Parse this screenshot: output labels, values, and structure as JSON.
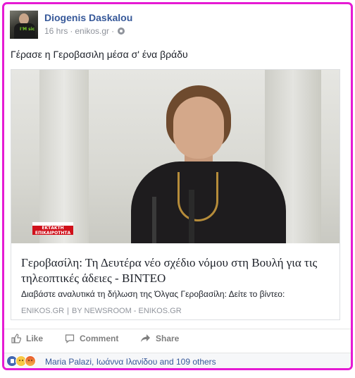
{
  "post": {
    "author_name": "Diogenis Daskalou",
    "time": "16 hrs",
    "source_separator": "·",
    "source_site": "enikos.gr",
    "privacy_separator": "·",
    "text": "Γέρασε η Γεροβασιλη μέσα σ' ένα βράδυ"
  },
  "avatar": {
    "shirt_text": "I'M sic"
  },
  "link_card": {
    "badge_line1": "ΕΚΤΑΚΤΗ",
    "badge_line2": "ΕΠΙΚΑΙΡΟΤΗΤΑ",
    "title": "Γεροβασίλη: Τη Δευτέρα νέο σχέδιο νόμου στη Βουλή για τις τηλεοπτικές άδειες - ΒΙΝΤΕΟ",
    "description": "Διαβάστε αναλυτικά τη δήλωση της Όλγας Γεροβασίλη: Δείτε το βίντεο:",
    "domain": "ENIKOS.GR",
    "separator": "|",
    "byline": "BY NEWSROOM - ENIKOS.GR"
  },
  "actions": {
    "like_label": "Like",
    "comment_label": "Comment",
    "share_label": "Share"
  },
  "reactions": {
    "icons": [
      "like-reaction-icon",
      "haha-reaction-icon",
      "angry-reaction-icon"
    ],
    "summary": "Maria Palazi, Ιωάννα Ιλανίδου and 109 others"
  },
  "colors": {
    "highlight_border": "#e51bd3",
    "link_blue": "#365899",
    "meta_gray": "#90949c"
  }
}
